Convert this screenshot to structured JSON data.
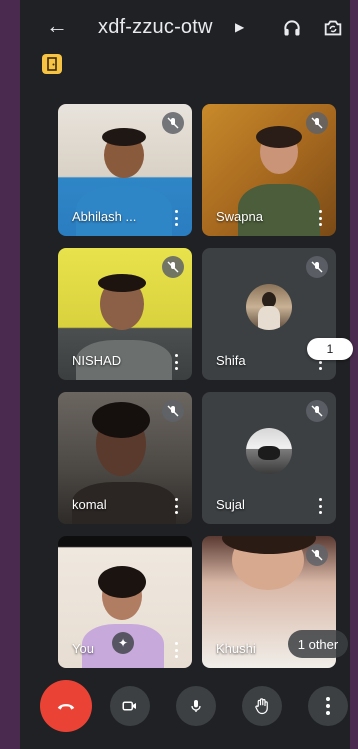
{
  "meeting": {
    "code": "xdf-zzuc-otw"
  },
  "participants": [
    {
      "name": "Abhilash ..."
    },
    {
      "name": "Swapna"
    },
    {
      "name": "NISHAD"
    },
    {
      "name": "Shifa"
    },
    {
      "name": "komal"
    },
    {
      "name": "Sujal"
    },
    {
      "name": "You"
    },
    {
      "name": "Khushi"
    }
  ],
  "badges": {
    "unread_count": "1",
    "others": "1 other"
  },
  "icons": {
    "back": "arrow-left-icon",
    "headset": "headset-icon",
    "camera_flip": "camera-flip-icon",
    "door": "door-exit-icon",
    "mic_off": "mic-off-icon",
    "effects": "sparkles-icon",
    "end_call": "end-call-icon",
    "video": "video-icon",
    "mic": "mic-icon",
    "hand": "raise-hand-icon",
    "more": "more-vert-icon"
  },
  "colors": {
    "end_call": "#ea4335",
    "background": "#202124",
    "tile": "#3c4043",
    "badge": "#f6c344"
  }
}
